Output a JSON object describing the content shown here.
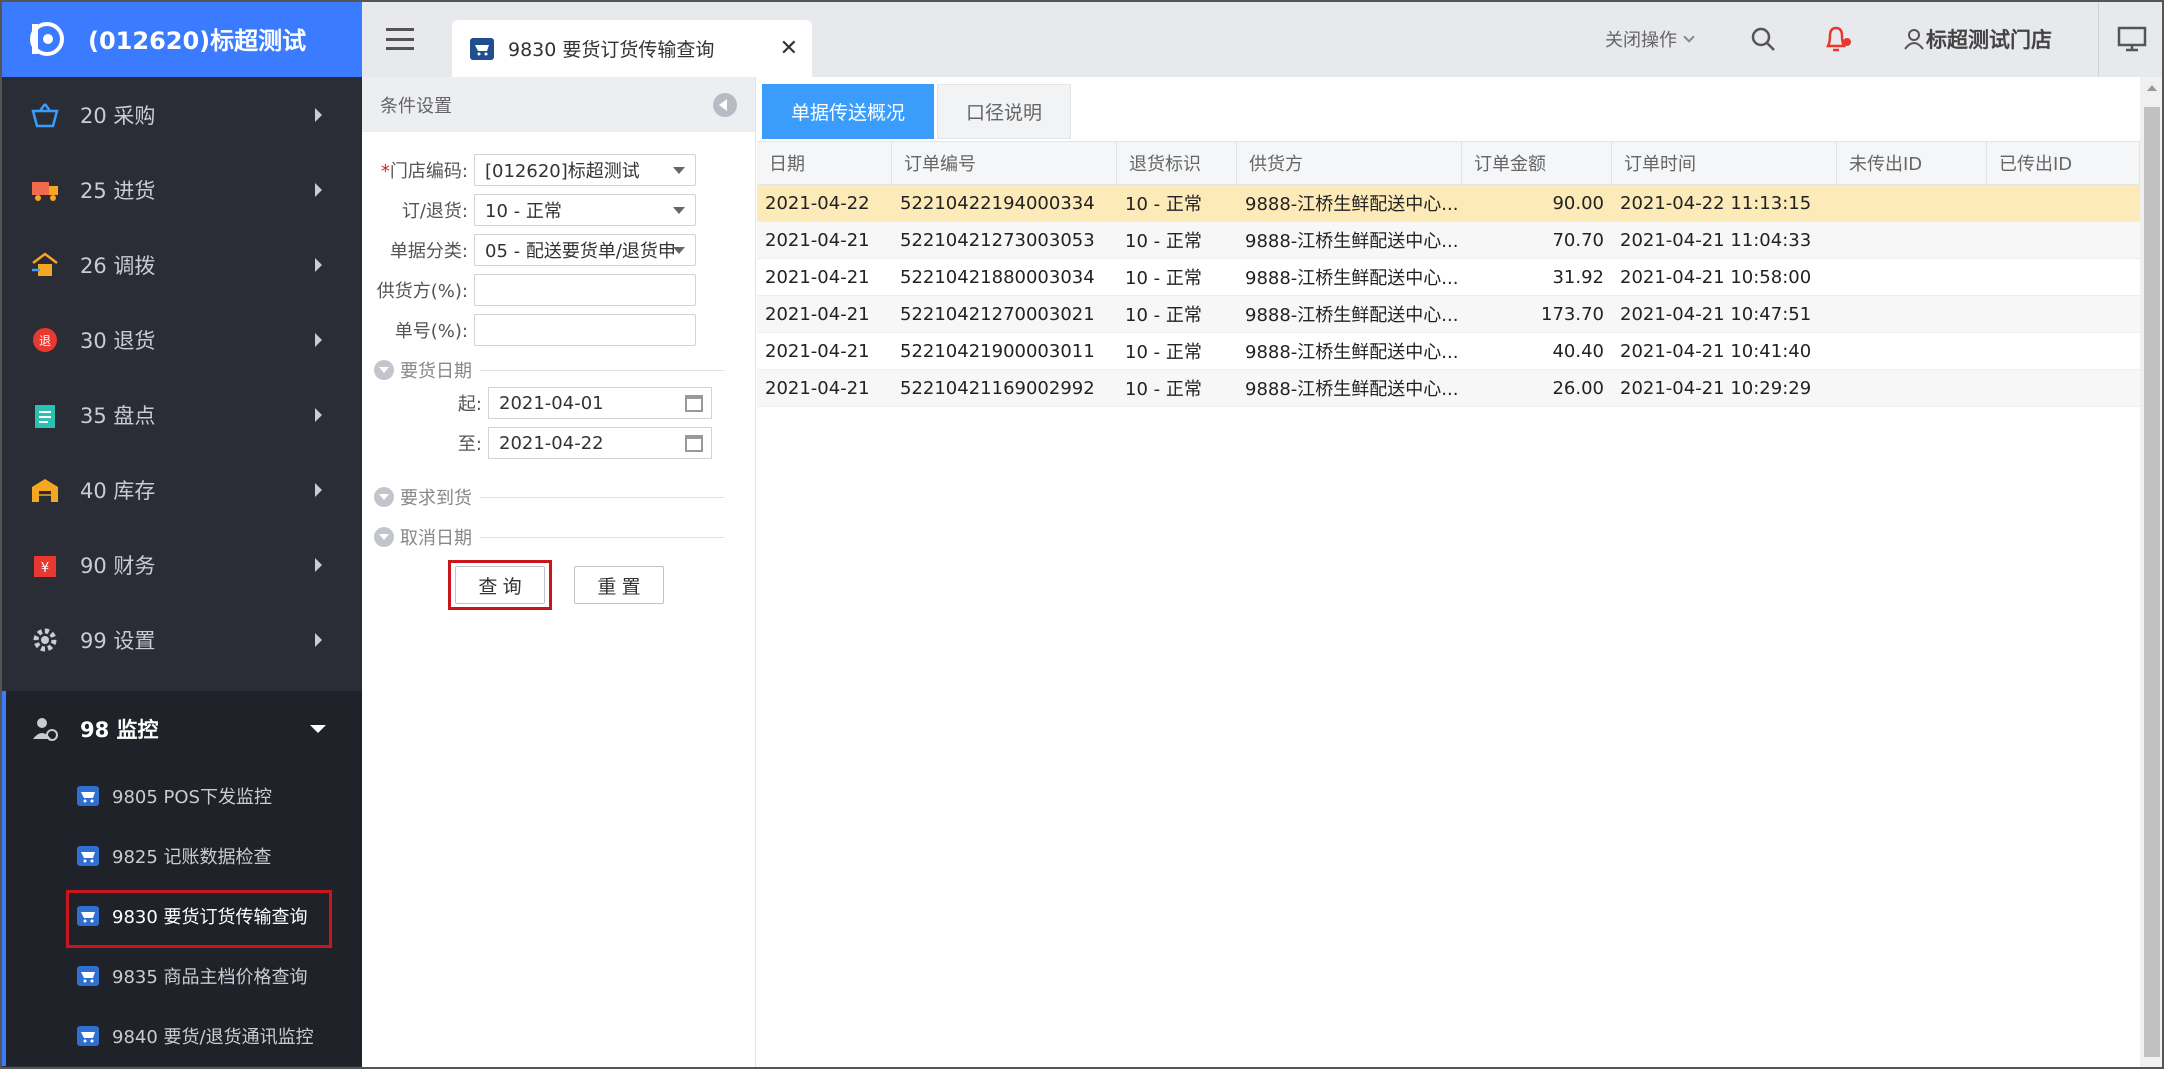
{
  "brand": {
    "title": "(012620)标超测试"
  },
  "sidebar": {
    "items": [
      {
        "label": "20 采购",
        "icon": "basket-icon",
        "color": "#3b9dfb"
      },
      {
        "label": "25 进货",
        "icon": "truck-icon",
        "color": "#f06a4f"
      },
      {
        "label": "26 调拨",
        "icon": "transfer-house-icon",
        "color": "#f5a623"
      },
      {
        "label": "30 退货",
        "icon": "return-badge-icon",
        "color": "#e8382f"
      },
      {
        "label": "35 盘点",
        "icon": "clipboard-icon",
        "color": "#2bc1b0"
      },
      {
        "label": "40 库存",
        "icon": "warehouse-icon",
        "color": "#f5a623"
      },
      {
        "label": "90 财务",
        "icon": "finance-icon",
        "color": "#e8382f"
      },
      {
        "label": "99 设置",
        "icon": "gear-icon",
        "color": "#c9ccd3"
      }
    ],
    "active": {
      "label": "98 监控",
      "icon": "monitor-user-icon"
    },
    "sub_items": [
      {
        "label": "9805 POS下发监控"
      },
      {
        "label": "9825 记账数据检查"
      },
      {
        "label": "9830 要货订货传输查询"
      },
      {
        "label": "9835 商品主档价格查询"
      },
      {
        "label": "9840 要货/退货通讯监控"
      }
    ]
  },
  "topbar": {
    "tab_title": "9830 要货订货传输查询",
    "tab_close": "✕",
    "close_ops": "关闭操作",
    "user": "标超测试门店"
  },
  "conditions": {
    "header": "条件设置",
    "store_code_label": "门店编码:",
    "store_code_required": "*",
    "store_code_value": "[012620]标超测试",
    "order_type_label": "订/退货:",
    "order_type_value": "10 - 正常",
    "doc_category_label": "单据分类:",
    "doc_category_value": "05 - 配送要货单/退货申",
    "supplier_label": "供货方(%):",
    "supplier_value": "",
    "doc_no_label": "单号(%):",
    "doc_no_value": "",
    "group_order_date": "要货日期",
    "from_label": "起:",
    "from_value": "2021-04-01",
    "to_label": "至:",
    "to_value": "2021-04-22",
    "group_arrival": "要求到货",
    "group_cancel": "取消日期",
    "query_button": "查 询",
    "reset_button": "重 置"
  },
  "content_tabs": [
    "单据传送概况",
    "口径说明"
  ],
  "table": {
    "columns": [
      "日期",
      "订单编号",
      "退货标识",
      "供货方",
      "订单金额",
      "订单时间",
      "未传出ID",
      "已传出ID"
    ],
    "rows": [
      [
        "2021-04-22",
        "52210422194000334",
        "10 - 正常",
        "9888-江桥生鲜配送中心...",
        "90.00",
        "2021-04-22 11:13:15",
        "",
        ""
      ],
      [
        "2021-04-21",
        "52210421273003053",
        "10 - 正常",
        "9888-江桥生鲜配送中心...",
        "70.70",
        "2021-04-21 11:04:33",
        "",
        ""
      ],
      [
        "2021-04-21",
        "52210421880003034",
        "10 - 正常",
        "9888-江桥生鲜配送中心...",
        "31.92",
        "2021-04-21 10:58:00",
        "",
        ""
      ],
      [
        "2021-04-21",
        "52210421270003021",
        "10 - 正常",
        "9888-江桥生鲜配送中心...",
        "173.70",
        "2021-04-21 10:47:51",
        "",
        ""
      ],
      [
        "2021-04-21",
        "52210421900003011",
        "10 - 正常",
        "9888-江桥生鲜配送中心...",
        "40.40",
        "2021-04-21 10:41:40",
        "",
        ""
      ],
      [
        "2021-04-21",
        "52210421169002992",
        "10 - 正常",
        "9888-江桥生鲜配送中心...",
        "26.00",
        "2021-04-21 10:29:29",
        "",
        ""
      ]
    ]
  },
  "colors": {
    "accent": "#3a7bff",
    "sidebar_bg": "#2a2d35",
    "tab_blue": "#3b9dfb",
    "highlight_row": "#fdeab9",
    "annotation_red": "#c8161d"
  }
}
